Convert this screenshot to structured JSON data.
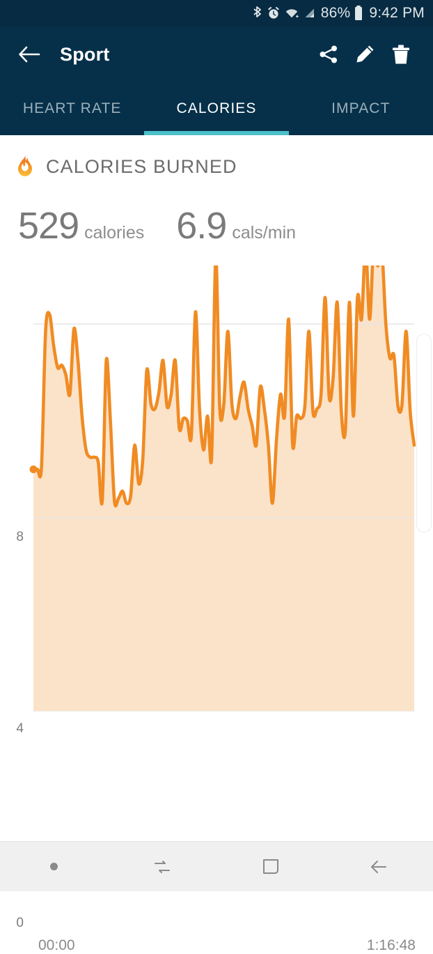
{
  "status_bar": {
    "icons": [
      "bluetooth-icon",
      "alarm-icon",
      "wifi-icon",
      "cellular-signal-icon"
    ],
    "battery_percent": "86%",
    "battery_icon": "battery-icon",
    "time": "9:42 PM"
  },
  "app_bar": {
    "back_icon": "back-arrow-icon",
    "title": "Sport",
    "actions": [
      {
        "name": "share-icon",
        "label": "Share"
      },
      {
        "name": "edit-icon",
        "label": "Edit"
      },
      {
        "name": "delete-icon",
        "label": "Delete"
      }
    ]
  },
  "tabs": {
    "items": [
      {
        "label": "HEART RATE",
        "active": false
      },
      {
        "label": "CALORIES",
        "active": true
      },
      {
        "label": "IMPACT",
        "active": false
      }
    ],
    "indicator_color": "#4BC0C8"
  },
  "section": {
    "icon": "flame-icon",
    "title": "CALORIES BURNED"
  },
  "stats": [
    {
      "value": "529",
      "unit": "calories"
    },
    {
      "value": "6.9",
      "unit": "cals/min"
    }
  ],
  "colors": {
    "header_bg": "#063049",
    "status_bg": "#062B42",
    "accent_teal": "#4BC0C8",
    "line_orange": "#F08B23",
    "fill_orange": "#FBE3C9",
    "text_gray": "#6B6B6B",
    "nav_bg": "#F0F0F0"
  },
  "chart_data": {
    "type": "area",
    "title": "CALORIES BURNED",
    "xlabel": "",
    "ylabel": "",
    "grid": true,
    "legend": null,
    "x_tick_labels": [
      "00:00",
      "1:16:48"
    ],
    "y_tick_labels": [
      "8",
      "4",
      "0"
    ],
    "y_ticks": [
      8,
      4,
      0
    ],
    "ylim": [
      0,
      12
    ],
    "xlim": [
      0,
      4608
    ],
    "duration_seconds": 4608,
    "duration_label": "1:16:48",
    "units": "cals/min",
    "total_calories": 529,
    "average_rate": 6.9,
    "start_marker": true,
    "values": [
      5.0,
      5.0,
      5.05,
      7.85,
      8.2,
      7.55,
      7.1,
      7.15,
      6.95,
      6.55,
      7.9,
      7.25,
      6.1,
      5.4,
      5.25,
      5.25,
      5.15,
      4.35,
      7.25,
      6.0,
      4.35,
      4.4,
      4.55,
      4.3,
      4.45,
      5.5,
      4.7,
      5.2,
      7.05,
      6.35,
      6.25,
      6.6,
      7.25,
      6.3,
      6.55,
      7.25,
      5.85,
      6.05,
      6.0,
      5.7,
      8.25,
      6.25,
      5.4,
      6.1,
      5.25,
      9.4,
      6.25,
      6.35,
      7.85,
      6.35,
      6.05,
      6.5,
      6.8,
      6.25,
      5.9,
      5.5,
      6.7,
      6.25,
      5.5,
      4.3,
      5.6,
      6.55,
      6.1,
      8.1,
      5.5,
      6.1,
      6.05,
      6.3,
      7.85,
      6.2,
      6.25,
      6.55,
      8.55,
      6.5,
      6.9,
      8.45,
      6.2,
      5.8,
      8.45,
      6.1,
      8.55,
      8.1,
      9.6,
      8.1,
      9.65,
      9.2,
      9.55,
      8.0,
      7.3,
      7.35,
      6.3,
      6.35,
      7.85,
      6.2,
      5.5
    ]
  },
  "nav_bar": {
    "items": [
      {
        "name": "nav-dot-icon",
        "label": "Menu"
      },
      {
        "name": "recents-icon",
        "label": "Recents"
      },
      {
        "name": "home-icon",
        "label": "Home"
      },
      {
        "name": "back-icon",
        "label": "Back"
      }
    ]
  }
}
